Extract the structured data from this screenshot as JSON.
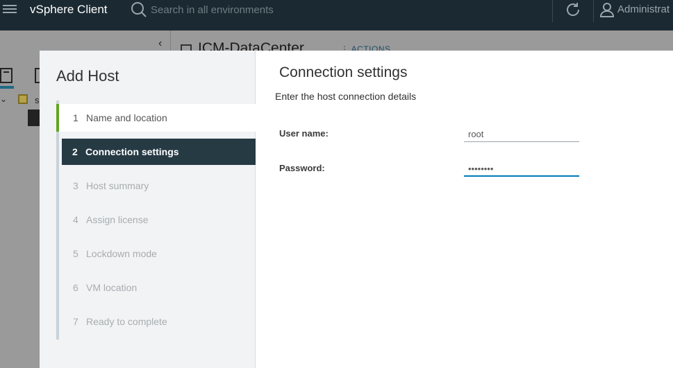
{
  "header": {
    "brand": "vSphere Client",
    "search_placeholder": "Search in all environments",
    "user_label": "Administrat"
  },
  "background": {
    "datacenter_title": "ICM-DataCenter",
    "actions_label": "ACTIONS",
    "tree_item_label": "s"
  },
  "wizard": {
    "title": "Add Host",
    "steps": [
      {
        "num": "1",
        "label": "Name and location",
        "state": "done"
      },
      {
        "num": "2",
        "label": "Connection settings",
        "state": "current"
      },
      {
        "num": "3",
        "label": "Host summary",
        "state": "pending"
      },
      {
        "num": "4",
        "label": "Assign license",
        "state": "pending"
      },
      {
        "num": "5",
        "label": "Lockdown mode",
        "state": "pending"
      },
      {
        "num": "6",
        "label": "VM location",
        "state": "pending"
      },
      {
        "num": "7",
        "label": "Ready to complete",
        "state": "pending"
      }
    ],
    "content": {
      "title": "Connection settings",
      "description": "Enter the host connection details",
      "username_label": "User name:",
      "username_value": "root",
      "password_label": "Password:",
      "password_value": "••••••••"
    }
  },
  "colors": {
    "header_bg": "#1b2a32",
    "current_step_bg": "#263a44",
    "done_step_accent": "#62a420",
    "focus_accent": "#0079b8"
  }
}
